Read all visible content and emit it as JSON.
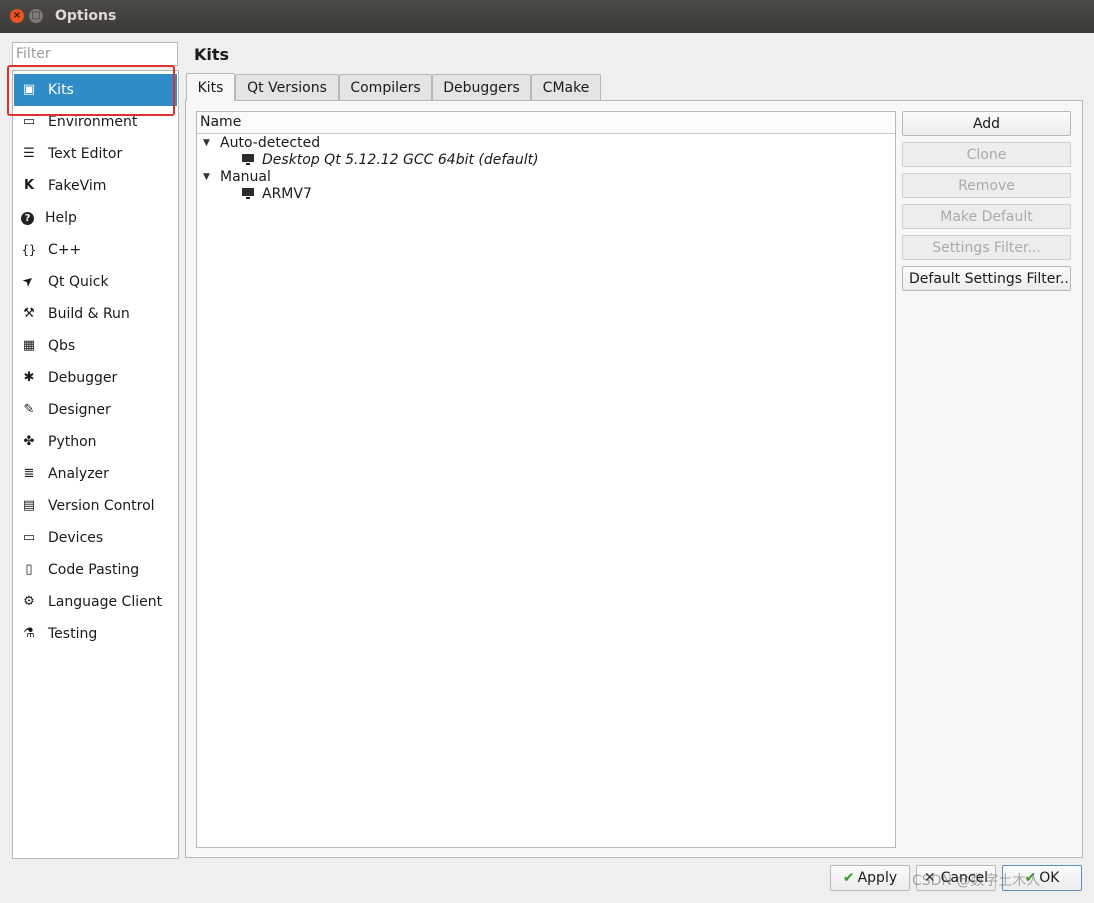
{
  "window": {
    "title": "Options",
    "close_glyph": "×",
    "max_glyph": "□"
  },
  "filter": {
    "placeholder": "Filter",
    "value": ""
  },
  "sidebar": {
    "items": [
      {
        "label": "Kits",
        "icon": "kits-icon",
        "glyph": "▣",
        "selected": true
      },
      {
        "label": "Environment",
        "icon": "monitor-icon",
        "glyph": "▭"
      },
      {
        "label": "Text Editor",
        "icon": "text-editor-icon",
        "glyph": "☰"
      },
      {
        "label": "FakeVim",
        "icon": "fakevim-icon",
        "glyph": "K"
      },
      {
        "label": "Help",
        "icon": "help-icon",
        "glyph": "?"
      },
      {
        "label": "C++",
        "icon": "braces-icon",
        "glyph": "{}"
      },
      {
        "label": "Qt Quick",
        "icon": "paper-plane-icon",
        "glyph": "➤"
      },
      {
        "label": "Build & Run",
        "icon": "hammer-icon",
        "glyph": "⚒"
      },
      {
        "label": "Qbs",
        "icon": "grid-icon",
        "glyph": "▦"
      },
      {
        "label": "Debugger",
        "icon": "bug-icon",
        "glyph": "✱"
      },
      {
        "label": "Designer",
        "icon": "pen-icon",
        "glyph": "✎"
      },
      {
        "label": "Python",
        "icon": "python-icon",
        "glyph": "✤"
      },
      {
        "label": "Analyzer",
        "icon": "analyzer-icon",
        "glyph": "≣"
      },
      {
        "label": "Version Control",
        "icon": "version-control-icon",
        "glyph": "▤"
      },
      {
        "label": "Devices",
        "icon": "devices-icon",
        "glyph": "▭"
      },
      {
        "label": "Code Pasting",
        "icon": "clipboard-icon",
        "glyph": "▯"
      },
      {
        "label": "Language Client",
        "icon": "language-client-icon",
        "glyph": "⚙"
      },
      {
        "label": "Testing",
        "icon": "testing-icon",
        "glyph": "⚗"
      }
    ]
  },
  "page": {
    "title": "Kits"
  },
  "tabs": [
    {
      "label": "Kits",
      "active": true
    },
    {
      "label": "Qt Versions"
    },
    {
      "label": "Compilers"
    },
    {
      "label": "Debuggers"
    },
    {
      "label": "CMake"
    }
  ],
  "tree": {
    "header": "Name",
    "groups": [
      {
        "label": "Auto-detected",
        "children": [
          {
            "label": "Desktop Qt 5.12.12 GCC 64bit (default)",
            "italic": true
          }
        ]
      },
      {
        "label": "Manual",
        "children": [
          {
            "label": "ARMV7"
          }
        ]
      }
    ]
  },
  "buttons": {
    "add": "Add",
    "clone": "Clone",
    "remove": "Remove",
    "make_default": "Make Default",
    "settings_filter": "Settings Filter...",
    "default_settings_filter": "Default Settings Filter..."
  },
  "dialog": {
    "apply": "Apply",
    "cancel": "Cancel",
    "ok": "OK"
  },
  "watermark": "CSDN @数字土木人",
  "colors": {
    "selection": "#308cc6",
    "annotation_box": "#e0302e",
    "titlebar": "#3c3b37"
  }
}
